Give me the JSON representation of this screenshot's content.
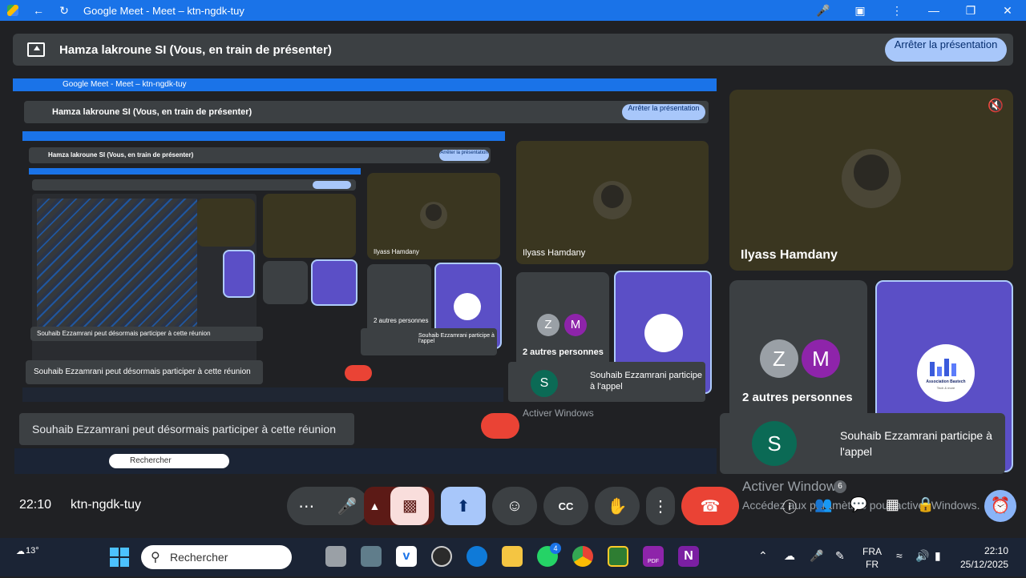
{
  "window": {
    "title": "Google Meet - Meet – ktn-ngdk-tuy",
    "back_icon": "back-arrow-icon",
    "reload_icon": "reload-icon"
  },
  "banner": {
    "text": "Hamza lakroune SI (Vous, en train de présenter)",
    "stop_label": "Arrêter la présentation"
  },
  "tiles": {
    "ilyass": {
      "name": "Ilyass Hamdany"
    },
    "others": {
      "z": "Z",
      "m": "M",
      "label": "2 autres personnes"
    },
    "assoc": {
      "org_name": "Association Bastech",
      "sub": "Tech & more"
    }
  },
  "notifications": {
    "join": "Souhaib Ezzamrani peut désormais participer à cette réunion",
    "call_initial": "S",
    "call_text": "Souhaib Ezzamrani participe à l'appel"
  },
  "meeting": {
    "time": "22:10",
    "code": "ktn-ngdk-tuy"
  },
  "activate": {
    "line1": "Activer Windows",
    "line2": "Accédez aux paramètres pour activer Windows.",
    "badge": "6"
  },
  "taskbar": {
    "weather": "13°",
    "search_placeholder": "Rechercher",
    "lang1": "FRA",
    "lang2": "FR",
    "clock_time": "22:10",
    "clock_date": "25/12/2025",
    "whatsapp_badge": "4",
    "pdf_label": "PDF"
  },
  "colors": {
    "accent": "#1a73e8",
    "leave_red": "#ea4335",
    "pill": "#a8c7fa",
    "surface": "#3c4043",
    "background": "#202124"
  }
}
